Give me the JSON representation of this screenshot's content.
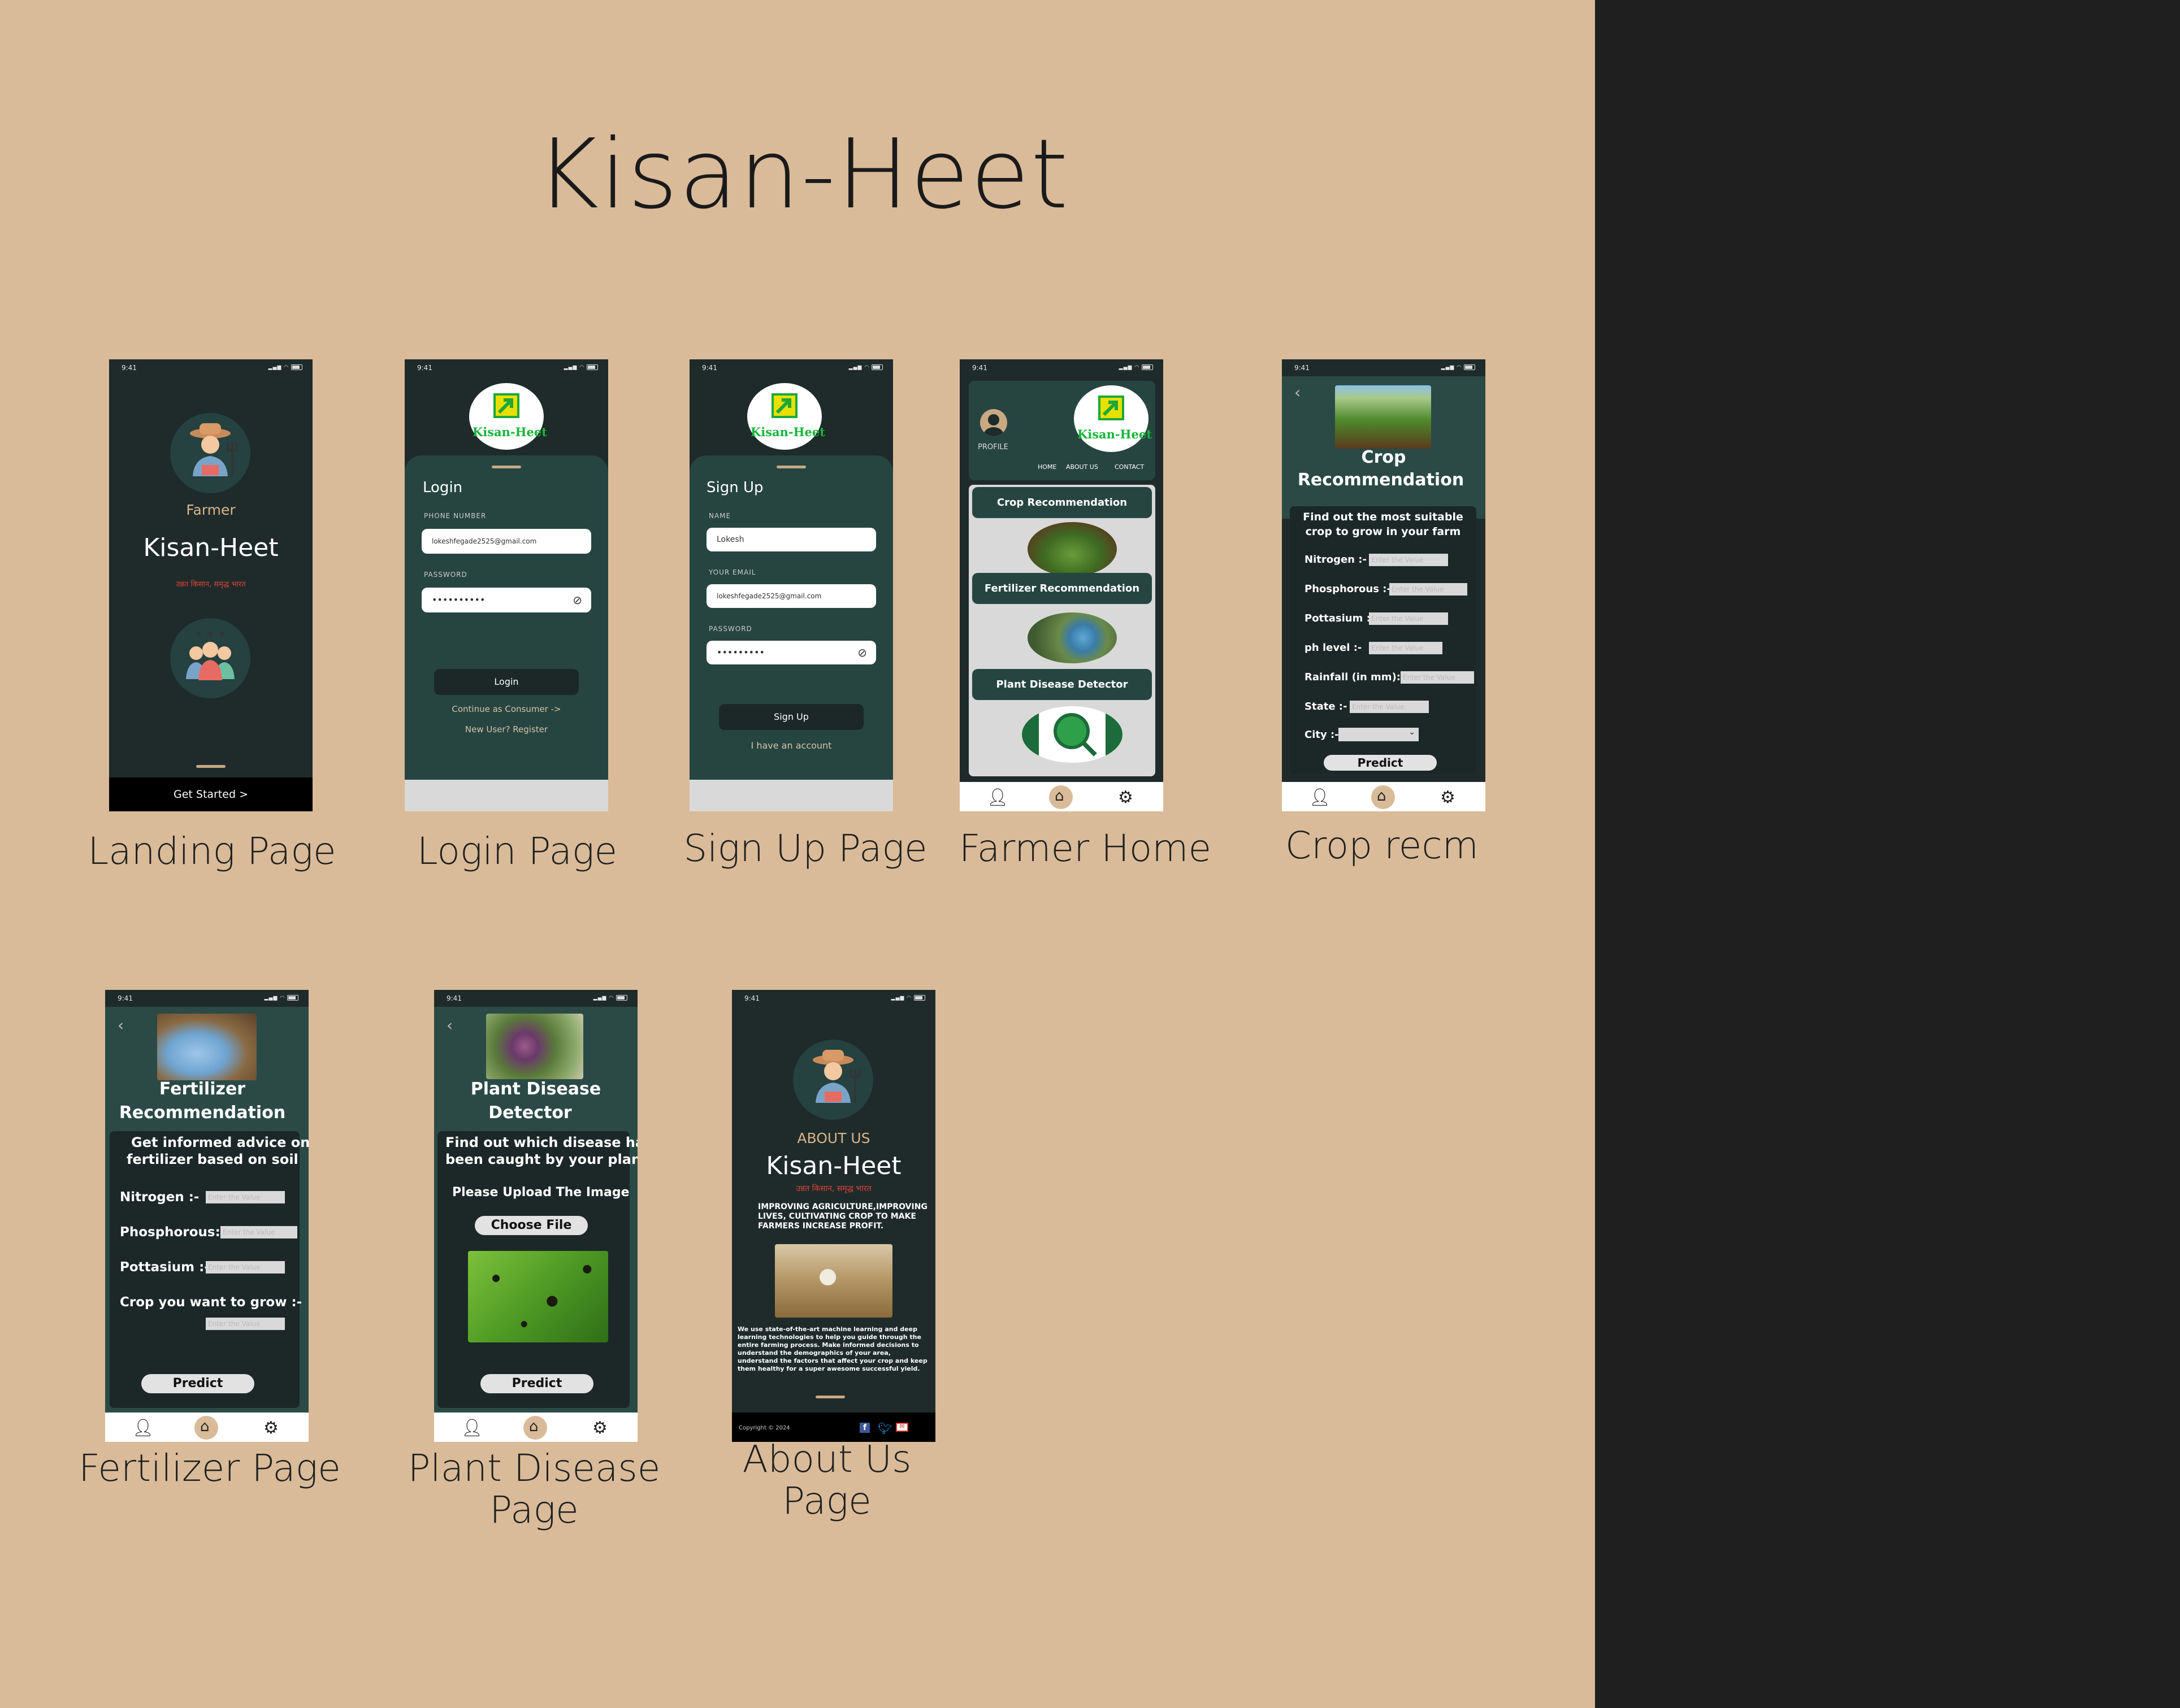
{
  "board": {
    "title": "Kisan-Heet",
    "captions": {
      "landing": "Landing Page",
      "login": "Login Page",
      "signup": "Sign Up Page",
      "farmer_home": "Farmer Home",
      "crop": "Crop recm",
      "fertilizer": "Fertilizer Page",
      "disease_1": "Plant Disease",
      "disease_2": "Page",
      "about_1": "About Us",
      "about_2": "Page"
    }
  },
  "status": {
    "time": "9:41"
  },
  "colors": {
    "canvas": "#d9bb99",
    "screen": "#1e2b2a",
    "sheet": "#264541",
    "accent": "#c9a984",
    "logo_green": "#18b53a",
    "tagline_red": "#e0403a"
  },
  "landing": {
    "role": "Farmer",
    "app_name": "Kisan-Heet",
    "tagline": "उन्नत किसान, समृद्ध भारत",
    "cta": "Get Started >",
    "icons": [
      "farmer-avatar-icon",
      "community-group-icon"
    ]
  },
  "logo": {
    "text": "Kisan-Heet",
    "icon": "growth-arrow-icon"
  },
  "login": {
    "heading": "Login",
    "phone_label": "PHONE NUMBER",
    "phone_value": "lokeshfegade2525@gmail.com",
    "password_label": "PASSWORD",
    "password_value": "••••••••••",
    "button": "Login",
    "consumer_link": "Continue as Consumer ->",
    "register_link": "New User? Register"
  },
  "signup": {
    "heading": "Sign Up",
    "name_label": "NAME",
    "name_value": "Lokesh",
    "email_label": "YOUR EMAIL",
    "email_value": "lokeshfegade2525@gmail.com",
    "password_label": "PASSWORD",
    "password_value": "•••••••••",
    "button": "Sign Up",
    "login_link": "I have an account"
  },
  "home": {
    "profile": "PROFILE",
    "nav": [
      "HOME",
      "ABOUT US",
      "CONTACT"
    ],
    "cards": [
      "Crop Recommendation",
      "Fertilizer Recommendation",
      "Plant Disease Detector"
    ]
  },
  "crop": {
    "title_1": "Crop",
    "title_2": "Recommendation",
    "intro_1": "Find out the most suitable",
    "intro_2": "crop to grow in your farm",
    "fields": [
      {
        "label": "Nitrogen :-",
        "placeholder": "Enter the Value"
      },
      {
        "label": "Phosphorous :-",
        "placeholder": "Enter the Value"
      },
      {
        "label": "Pottasium :-",
        "placeholder": "Enter the Value"
      },
      {
        "label": "ph level :-",
        "placeholder": "Enter the Value"
      },
      {
        "label": "Rainfall (in mm):",
        "placeholder": "Enter the Value"
      },
      {
        "label": "State :-",
        "placeholder": "Enter the Value"
      }
    ],
    "city_label": "City :-",
    "button": "Predict"
  },
  "fertilizer": {
    "title_1": "Fertilizer",
    "title_2": "Recommendation",
    "intro_1": "Get informed advice on",
    "intro_2": "fertilizer based on soil",
    "fields": [
      {
        "label": "Nitrogen :-",
        "placeholder": "Enter the Value"
      },
      {
        "label": "Phosphorous:-",
        "placeholder": "Enter the Value"
      },
      {
        "label": "Pottasium :-",
        "placeholder": "Enter the Value"
      }
    ],
    "crop_label": "Crop you want to grow :-",
    "crop_placeholder": "Enter the Value",
    "button": "Predict"
  },
  "disease": {
    "title_1": "Plant Disease",
    "title_2": "Detector",
    "intro_1": "Find out which disease has",
    "intro_2": "been caught by your plant",
    "upload_label": "Please Upload The Image",
    "choose_button": "Choose File",
    "button": "Predict"
  },
  "about": {
    "heading": "ABOUT US",
    "app_name": "Kisan-Heet",
    "tagline": "उन्नत किसान, समृद्ध भारत",
    "mission_1": "IMPROVING AGRICULTURE,IMPROVING",
    "mission_2": "LIVES, CULTIVATING CROP TO MAKE",
    "mission_3": "FARMERS INCREASE PROFIT.",
    "body": [
      "We use state-of-the-art machine learning and deep",
      "learning technologies to help you guide through the",
      "entire farming process. Make informed decisions to",
      "understand the demographics of your area,",
      "understand the factors that affect your crop and keep",
      "them healthy for a super awesome successful yield."
    ],
    "copyright": "Copyright © 2024",
    "social": [
      "facebook-icon",
      "twitter-icon",
      "mail-icon"
    ]
  }
}
